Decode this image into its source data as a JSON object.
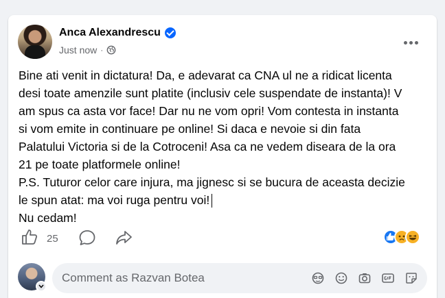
{
  "post": {
    "author": "Anca Alexandrescu",
    "time": "Just now",
    "separator": "·",
    "lines": [
      "Bine ati venit in dictatura! Da, e adevarat ca CNA ul ne a ridicat licenta",
      "desi toate amenzile sunt platite (inclusiv cele suspendate de instanta)! V",
      "am spus ca asta vor face! Dar nu ne vom opri! Vom contesta in instanta",
      "si vom emite in continuare pe online! Si daca e nevoie si din fata",
      "Palatului Victoria si de la Cotroceni! Asa ca ne vedem diseara de la ora",
      "21 pe toate platformele online!",
      "P.S. Tuturor celor care injura, ma jignesc si se bucura de aceasta decizie",
      "le spun atat: ma voi ruga pentru voi!",
      "Nu cedam!"
    ]
  },
  "actions": {
    "like_count": "25"
  },
  "comment": {
    "placeholder": "Comment as Razvan Botea"
  },
  "icons": {
    "verified": "verified-badge-icon",
    "privacy": "globe-icon",
    "more": "more-options-icon",
    "like": "thumbs-up-icon",
    "comment": "comment-bubble-icon",
    "share": "share-arrow-icon",
    "tools": [
      "avatar-sticker-icon",
      "emoji-icon",
      "camera-icon",
      "gif-icon",
      "sticker-icon"
    ]
  },
  "colors": {
    "accent": "#0866ff",
    "secondary_text": "#65676b",
    "background": "#f0f2f5"
  }
}
